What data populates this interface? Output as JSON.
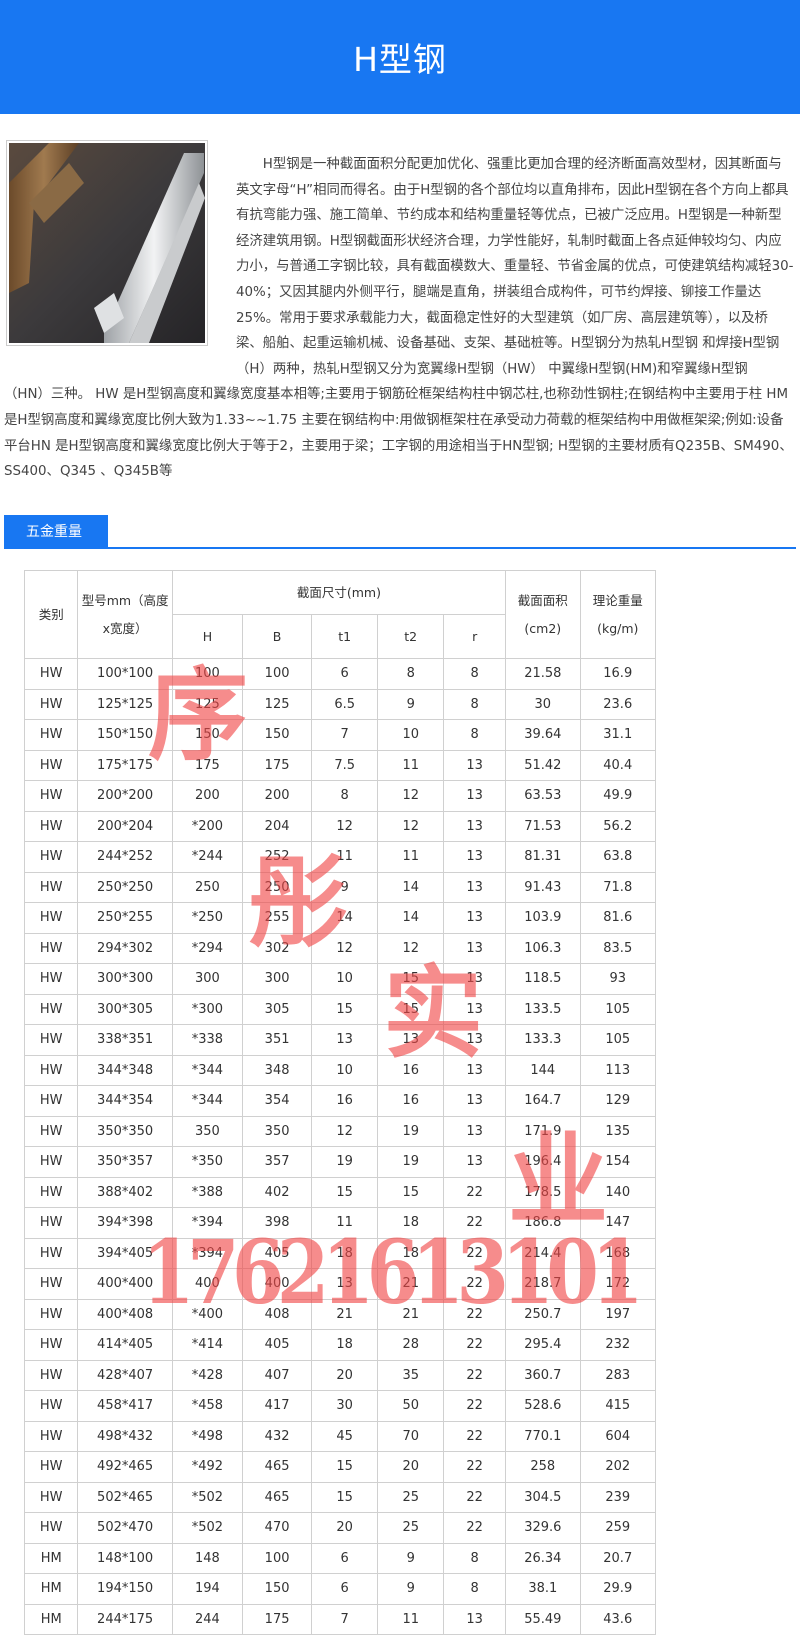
{
  "header": {
    "title": "H型钢"
  },
  "intro": {
    "p1": "H型钢是一种截面面积分配更加优化、强重比更加合理的经济断面高效型材，因其断面与英文字母“H”相同而得名。由于H型钢的各个部位均以直角排布，因此H型钢在各个方向上都具有抗弯能力强、施工简单、节约成本和结构重量轻等优点，已被广泛应用。H型钢是一种新型经济建筑用钢。H型钢截面形状经济合理，力学性能好，轧制时截面上各点延伸较均匀、内应力小，与普通工字钢比较，具有截面模数大、重量轻、节省金属的优点，可使建筑结构减轻30-40%；又因其腿内外侧平行，腿端是直角，拼装组合成构件，可节约焊接、铆接工作量达25%。常用于要求承载能力大，截面稳定性好的大型建筑（如厂房、高层建筑等），以及桥梁、船舶、起重运输机械、设备基础、支架、基础桩等。H型钢分为热轧H型钢 和焊接H型钢（H）两种，热轧H型钢又分为宽翼缘H型钢（HW） 中翼缘H型钢(HM)和窄翼缘H型钢",
    "p2": "（HN）三种。 HW 是H型钢高度和翼缘宽度基本相等;主要用于钢筋砼框架结构柱中钢芯柱,也称劲性钢柱;在钢结构中主要用于柱 HM 是H型钢高度和翼缘宽度比例大致为1.33~~1.75 主要在钢结构中:用做钢框架柱在承受动力荷载的框架结构中用做框架梁;例如:设备平台HN 是H型钢高度和翼缘宽度比例大于等于2，主要用于梁；工字钢的用途相当于HN型钢; H型钢的主要材质有Q235B、SM490、SS400、Q345 、Q345B等"
  },
  "section": {
    "tab": "五金重量"
  },
  "table": {
    "h_category": "类别",
    "h_model": "型号mm（高度x宽度）",
    "h_section": "截面尺寸(mm)",
    "h_area": "截面面积(cm2)",
    "h_weight": "理论重量(kg/m)",
    "sub": [
      "H",
      "B",
      "t1",
      "t2",
      "r"
    ],
    "rows": [
      [
        "HW",
        "100*100",
        "100",
        "100",
        "6",
        "8",
        "8",
        "21.58",
        "16.9"
      ],
      [
        "HW",
        "125*125",
        "125",
        "125",
        "6.5",
        "9",
        "8",
        "30",
        "23.6"
      ],
      [
        "HW",
        "150*150",
        "150",
        "150",
        "7",
        "10",
        "8",
        "39.64",
        "31.1"
      ],
      [
        "HW",
        "175*175",
        "175",
        "175",
        "7.5",
        "11",
        "13",
        "51.42",
        "40.4"
      ],
      [
        "HW",
        "200*200",
        "200",
        "200",
        "8",
        "12",
        "13",
        "63.53",
        "49.9"
      ],
      [
        "HW",
        "200*204",
        "*200",
        "204",
        "12",
        "12",
        "13",
        "71.53",
        "56.2"
      ],
      [
        "HW",
        "244*252",
        "*244",
        "252",
        "11",
        "11",
        "13",
        "81.31",
        "63.8"
      ],
      [
        "HW",
        "250*250",
        "250",
        "250",
        "9",
        "14",
        "13",
        "91.43",
        "71.8"
      ],
      [
        "HW",
        "250*255",
        "*250",
        "255",
        "14",
        "14",
        "13",
        "103.9",
        "81.6"
      ],
      [
        "HW",
        "294*302",
        "*294",
        "302",
        "12",
        "12",
        "13",
        "106.3",
        "83.5"
      ],
      [
        "HW",
        "300*300",
        "300",
        "300",
        "10",
        "15",
        "13",
        "118.5",
        "93"
      ],
      [
        "HW",
        "300*305",
        "*300",
        "305",
        "15",
        "15",
        "13",
        "133.5",
        "105"
      ],
      [
        "HW",
        "338*351",
        "*338",
        "351",
        "13",
        "13",
        "13",
        "133.3",
        "105"
      ],
      [
        "HW",
        "344*348",
        "*344",
        "348",
        "10",
        "16",
        "13",
        "144",
        "113"
      ],
      [
        "HW",
        "344*354",
        "*344",
        "354",
        "16",
        "16",
        "13",
        "164.7",
        "129"
      ],
      [
        "HW",
        "350*350",
        "350",
        "350",
        "12",
        "19",
        "13",
        "171.9",
        "135"
      ],
      [
        "HW",
        "350*357",
        "*350",
        "357",
        "19",
        "19",
        "13",
        "196.4",
        "154"
      ],
      [
        "HW",
        "388*402",
        "*388",
        "402",
        "15",
        "15",
        "22",
        "178.5",
        "140"
      ],
      [
        "HW",
        "394*398",
        "*394",
        "398",
        "11",
        "18",
        "22",
        "186.8",
        "147"
      ],
      [
        "HW",
        "394*405",
        "*394",
        "405",
        "18",
        "18",
        "22",
        "214.4",
        "168"
      ],
      [
        "HW",
        "400*400",
        "400",
        "400",
        "13",
        "21",
        "22",
        "218.7",
        "172"
      ],
      [
        "HW",
        "400*408",
        "*400",
        "408",
        "21",
        "21",
        "22",
        "250.7",
        "197"
      ],
      [
        "HW",
        "414*405",
        "*414",
        "405",
        "18",
        "28",
        "22",
        "295.4",
        "232"
      ],
      [
        "HW",
        "428*407",
        "*428",
        "407",
        "20",
        "35",
        "22",
        "360.7",
        "283"
      ],
      [
        "HW",
        "458*417",
        "*458",
        "417",
        "30",
        "50",
        "22",
        "528.6",
        "415"
      ],
      [
        "HW",
        "498*432",
        "*498",
        "432",
        "45",
        "70",
        "22",
        "770.1",
        "604"
      ],
      [
        "HW",
        "492*465",
        "*492",
        "465",
        "15",
        "20",
        "22",
        "258",
        "202"
      ],
      [
        "HW",
        "502*465",
        "*502",
        "465",
        "15",
        "25",
        "22",
        "304.5",
        "239"
      ],
      [
        "HW",
        "502*470",
        "*502",
        "470",
        "20",
        "25",
        "22",
        "329.6",
        "259"
      ],
      [
        "HM",
        "148*100",
        "148",
        "100",
        "6",
        "9",
        "8",
        "26.34",
        "20.7"
      ],
      [
        "HM",
        "194*150",
        "194",
        "150",
        "6",
        "9",
        "8",
        "38.1",
        "29.9"
      ],
      [
        "HM",
        "244*175",
        "244",
        "175",
        "7",
        "11",
        "13",
        "55.49",
        "43.6"
      ]
    ]
  },
  "watermark": {
    "c1": "序",
    "c2": "彤",
    "c3": "实",
    "c4": "业",
    "phone": "17621613101"
  }
}
